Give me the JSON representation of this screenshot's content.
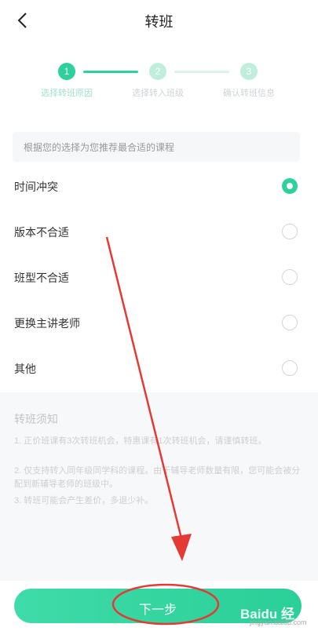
{
  "header": {
    "title": "转班"
  },
  "steps": [
    {
      "number": "1",
      "label": "选择转班原因",
      "active": true
    },
    {
      "number": "2",
      "label": "选择转入班级",
      "active": false
    },
    {
      "number": "3",
      "label": "确认转班信息",
      "active": false
    }
  ],
  "hint": "根据您的选择为您推荐最合适的课程",
  "options": [
    {
      "label": "时间冲突",
      "checked": true
    },
    {
      "label": "版本不合适",
      "checked": false
    },
    {
      "label": "班型不合适",
      "checked": false
    },
    {
      "label": "更换主讲老师",
      "checked": false
    },
    {
      "label": "其他",
      "checked": false
    }
  ],
  "notice": {
    "title": "转班须知",
    "items": [
      "1. 正价班课有3次转班机会，特惠课有1次转班机会，请谨慎转班。",
      "2. 仅支持转入同年级同学科的课程。由于辅导老师数量有限，您可能会被分配到新辅导老师的班级中。",
      "3. 转班可能会产生差价，多退少补。"
    ]
  },
  "bottom": {
    "next_label": "下一步",
    "watermark": "Baidu 经验",
    "watermark_url": "jingyan.baidu.com"
  },
  "colors": {
    "accent": "#2dd19b",
    "annotation": "#e53935"
  }
}
